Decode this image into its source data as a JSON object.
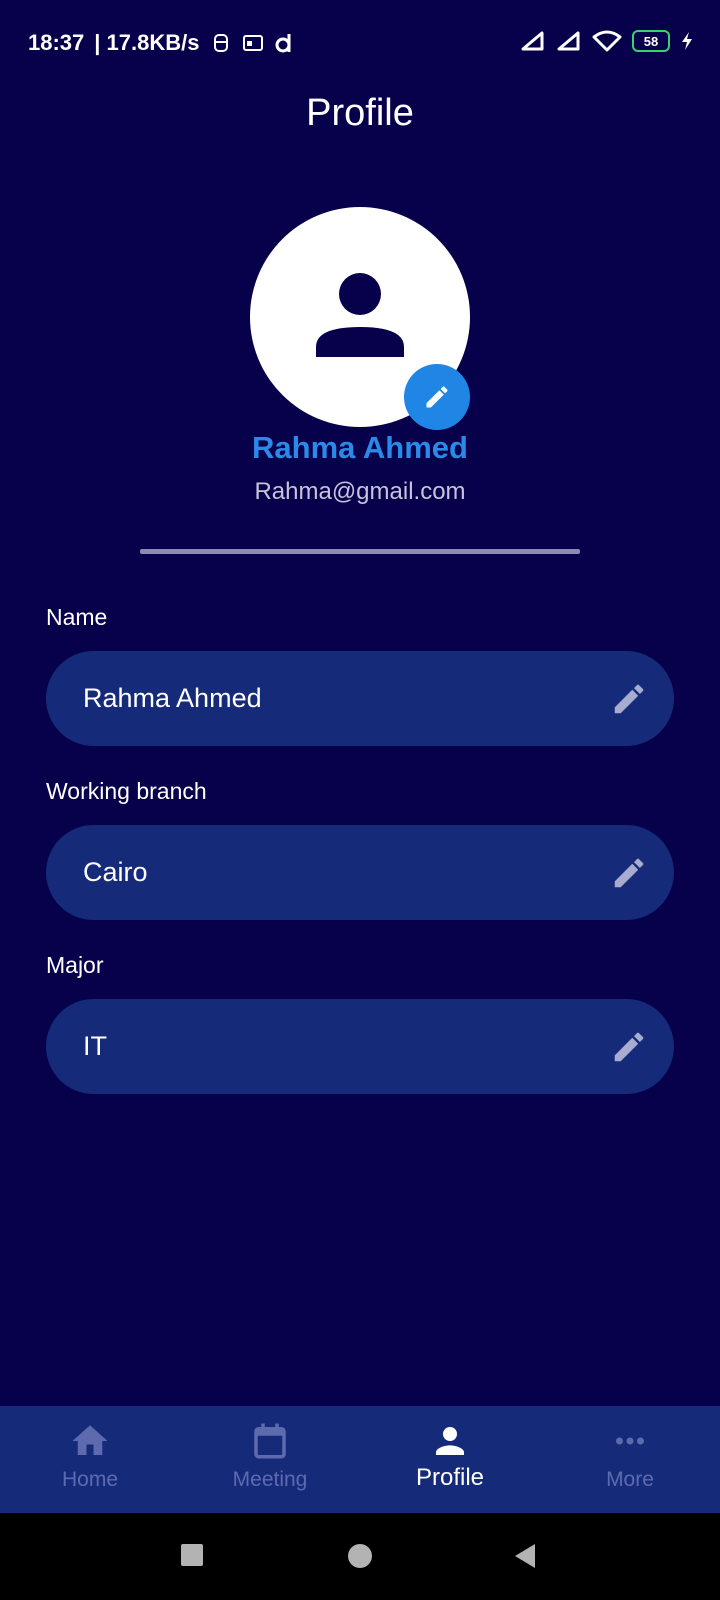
{
  "status_bar": {
    "time": "18:37",
    "net_speed": "| 17.8KB/s",
    "battery": "58"
  },
  "app": {
    "title": "Profile"
  },
  "profile": {
    "name": "Rahma Ahmed",
    "email": "Rahma@gmail.com"
  },
  "fields": [
    {
      "label": "Name",
      "value": "Rahma Ahmed"
    },
    {
      "label": "Working branch",
      "value": "Cairo"
    },
    {
      "label": "Major",
      "value": "IT"
    }
  ],
  "bottom_nav": {
    "items": [
      {
        "label": "Home",
        "icon": "home-icon",
        "active": false
      },
      {
        "label": "Meeting",
        "icon": "calendar-icon",
        "active": false
      },
      {
        "label": "Profile",
        "icon": "person-icon",
        "active": true
      },
      {
        "label": "More",
        "icon": "more-horizontal-icon",
        "active": false
      }
    ]
  },
  "colors": {
    "background": "#07004a",
    "card": "#162a7a",
    "accent": "#1f86e5",
    "name_text": "#2a8ae8",
    "inactive_nav": "#5e6aae"
  }
}
